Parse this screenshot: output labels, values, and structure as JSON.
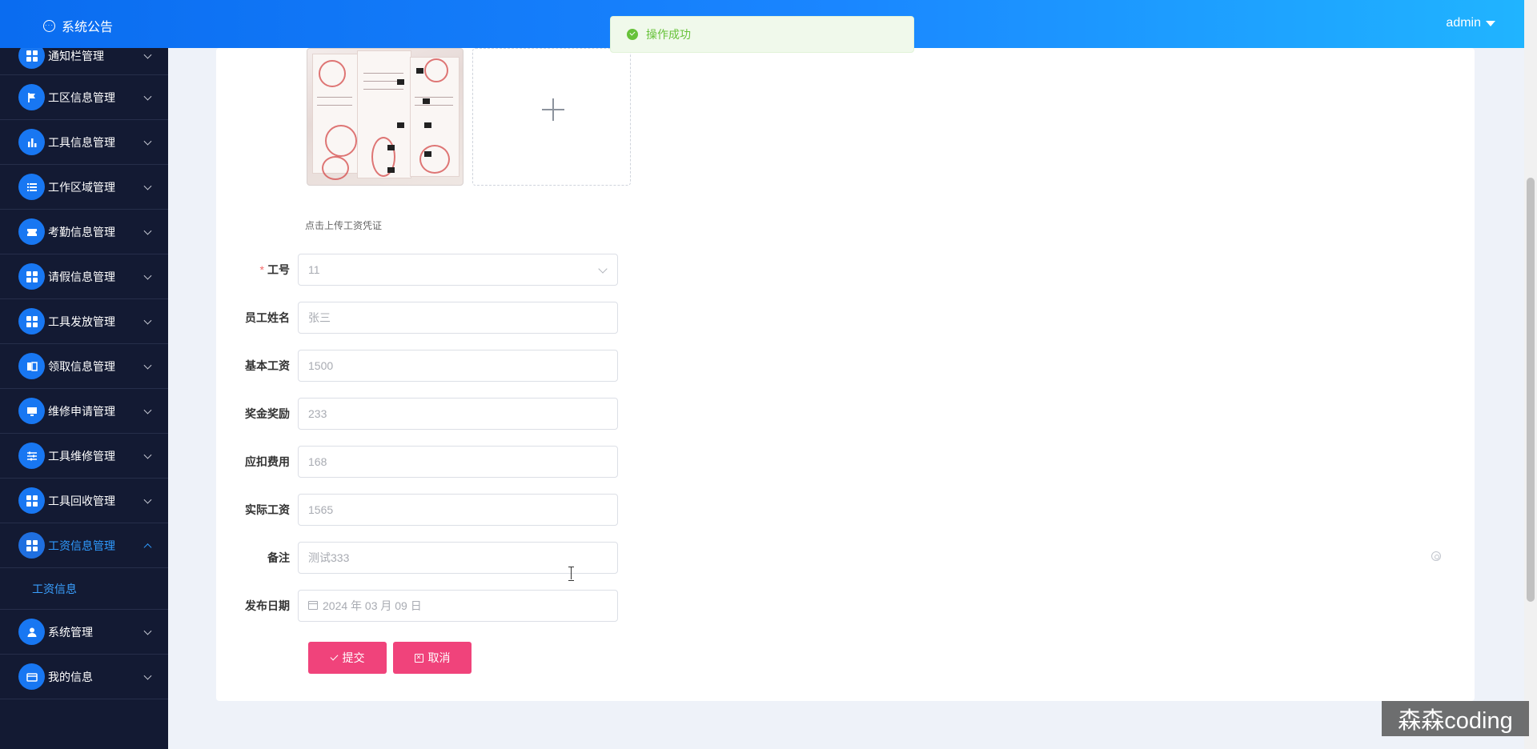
{
  "header": {
    "announcement": "系统公告",
    "user": "admin"
  },
  "toast": {
    "message": "操作成功",
    "type": "success",
    "color": "#67c23a"
  },
  "sidebar": {
    "items": [
      {
        "label": "通知栏管理",
        "icon": "grid-icon"
      },
      {
        "label": "工区信息管理",
        "icon": "flag-icon"
      },
      {
        "label": "工具信息管理",
        "icon": "bar-chart-icon"
      },
      {
        "label": "工作区域管理",
        "icon": "list-icon"
      },
      {
        "label": "考勤信息管理",
        "icon": "ticket-icon"
      },
      {
        "label": "请假信息管理",
        "icon": "grid-icon"
      },
      {
        "label": "工具发放管理",
        "icon": "grid-icon"
      },
      {
        "label": "领取信息管理",
        "icon": "book-icon"
      },
      {
        "label": "维修申请管理",
        "icon": "monitor-icon"
      },
      {
        "label": "工具维修管理",
        "icon": "sliders-icon"
      },
      {
        "label": "工具回收管理",
        "icon": "grid-icon"
      },
      {
        "label": "工资信息管理",
        "icon": "grid-icon",
        "expanded": true
      },
      {
        "label": "系统管理",
        "icon": "user-icon"
      },
      {
        "label": "我的信息",
        "icon": "wallet-icon"
      }
    ],
    "submenu": {
      "label": "工资信息"
    }
  },
  "form": {
    "upload_tip": "点击上传工资凭证",
    "fields": {
      "employee_no": {
        "label": "工号",
        "value": "11",
        "required": true
      },
      "name": {
        "label": "员工姓名",
        "value": "张三"
      },
      "base_salary": {
        "label": "基本工资",
        "value": "1500"
      },
      "bonus": {
        "label": "奖金奖励",
        "value": "233"
      },
      "deduction": {
        "label": "应扣费用",
        "value": "168"
      },
      "actual_salary": {
        "label": "实际工资",
        "value": "1565"
      },
      "remark": {
        "label": "备注",
        "value": "测试333"
      },
      "publish_date": {
        "label": "发布日期",
        "value": "2024 年 03 月 09 日"
      }
    },
    "submit_label": "提交",
    "cancel_label": "取消"
  },
  "watermark": "森森coding",
  "colors": {
    "accent": "#1877f2",
    "button": "#f0437b",
    "sidebar_bg": "#131a33"
  }
}
